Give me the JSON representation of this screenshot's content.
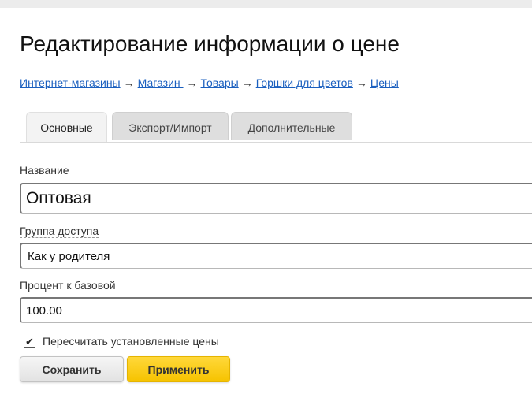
{
  "page": {
    "title": "Редактирование информации о цене"
  },
  "breadcrumb": [
    "Интернет-магазины",
    "Магазин ",
    "Товары",
    "Горшки для цветов",
    "Цены"
  ],
  "breadcrumb_separator": "→",
  "tabs": [
    {
      "label": "Основные",
      "active": true
    },
    {
      "label": "Экспорт/Импорт",
      "active": false
    },
    {
      "label": "Дополнительные",
      "active": false
    }
  ],
  "form": {
    "name": {
      "label": "Название",
      "value": "Оптовая"
    },
    "access_group": {
      "label": "Группа доступа",
      "value": "Как у родителя"
    },
    "percent": {
      "label": "Процент к базовой",
      "value": "100.00"
    },
    "recalc": {
      "label": "Пересчитать установленные цены",
      "checked": true,
      "check_glyph": "✔"
    }
  },
  "buttons": {
    "save": "Сохранить",
    "apply": "Применить"
  },
  "colors": {
    "link": "#1a5fbf",
    "apply_button": "#f6c300"
  }
}
